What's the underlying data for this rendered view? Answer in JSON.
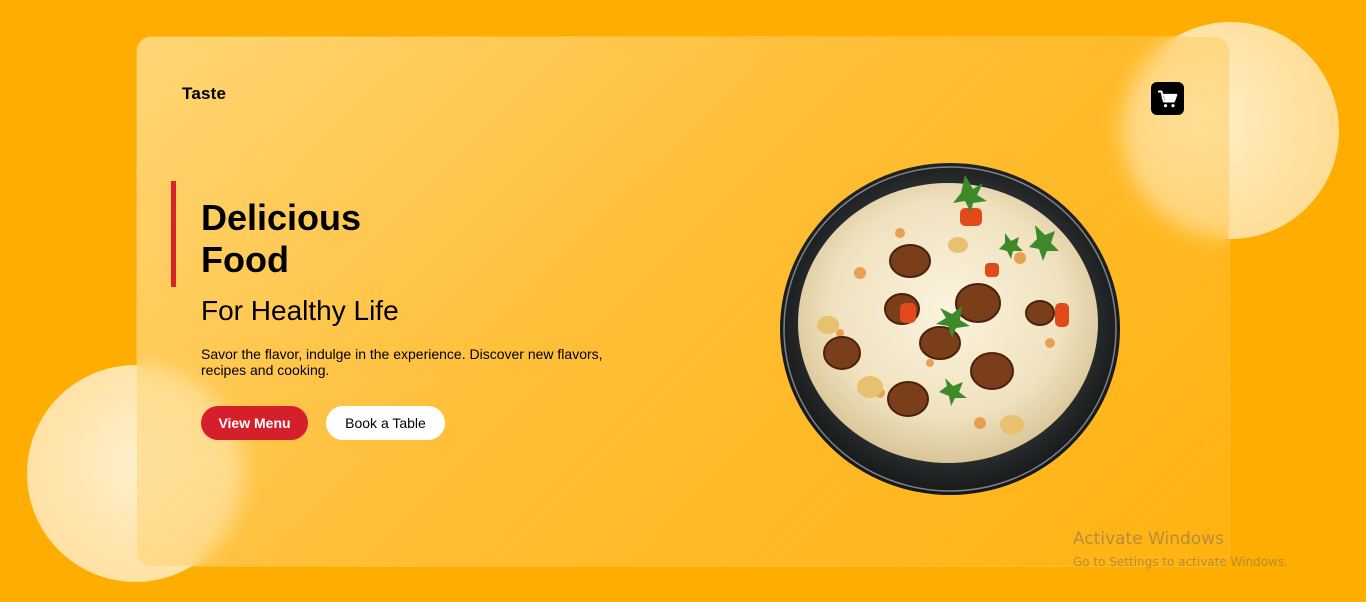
{
  "header": {
    "brand": "Taste",
    "cart_icon": "cart-icon"
  },
  "hero": {
    "headline_line1": "Delicious",
    "headline_line2": "Food",
    "subheadline": "For Healthy Life",
    "description": "Savor the flavor, indulge in the experience. Discover new flavors, recipes and cooking.",
    "primary_button": "View Menu",
    "secondary_button": "Book a Table",
    "image_alt": "Biryani rice with grilled chicken in a black bowl"
  },
  "watermark": {
    "title": "Activate Windows",
    "subtitle": "Go to Settings to activate Windows."
  },
  "colors": {
    "background": "#ffad00",
    "accent": "#d51f2a",
    "text": "#000000",
    "button_secondary_bg": "#ffffff"
  }
}
